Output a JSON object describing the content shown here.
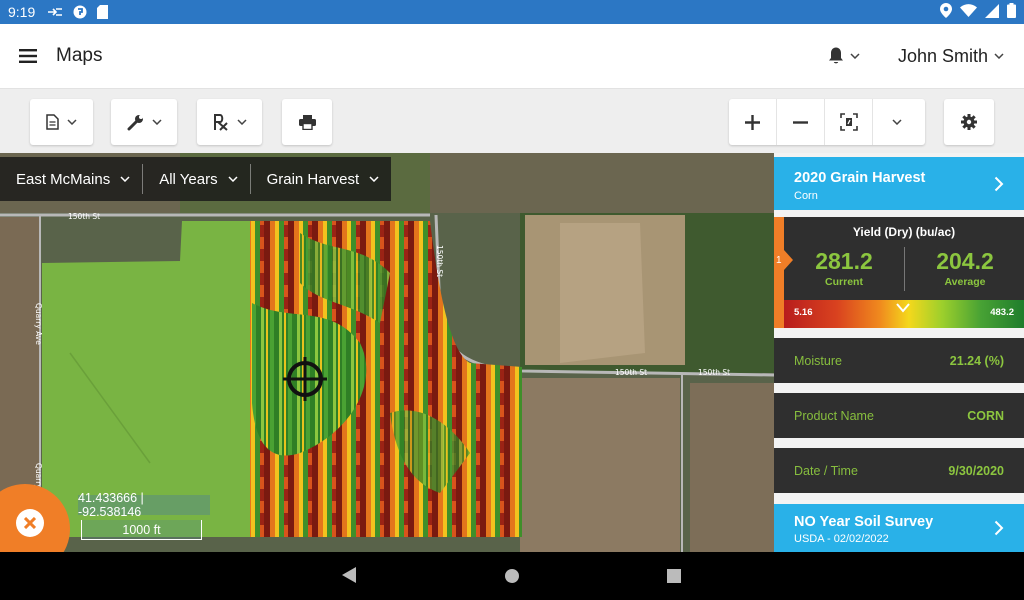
{
  "status_bar": {
    "time": "9:19"
  },
  "app_bar": {
    "title": "Maps",
    "user_name": "John Smith"
  },
  "map": {
    "filters": [
      {
        "label": "East McMains"
      },
      {
        "label": "All Years"
      },
      {
        "label": "Grain Harvest"
      }
    ],
    "road_labels": [
      "150th St",
      "150th St",
      "150th St",
      "150th St",
      "Quarry Ave",
      "Quarry Ave"
    ],
    "coordinates": "41.433666 | -92.538146",
    "scale": "1000 ft"
  },
  "panel": {
    "harvest_card": {
      "title": "2020 Grain Harvest",
      "subtitle": "Corn"
    },
    "yield": {
      "marker_number": "1",
      "title": "Yield (Dry) (bu/ac)",
      "current_value": "281.2",
      "current_label": "Current",
      "average_value": "204.2",
      "average_label": "Average",
      "scale_min": "5.16",
      "scale_max": "483.2"
    },
    "rows": [
      {
        "label": "Moisture",
        "value": "21.24 (%)"
      },
      {
        "label": "Product Name",
        "value": "CORN"
      },
      {
        "label": "Date / Time",
        "value": "9/30/2020"
      }
    ],
    "soil_card": {
      "title": "NO Year Soil Survey",
      "subtitle": "USDA - 02/02/2022"
    }
  },
  "colors": {
    "status_bar": "#2c77c4",
    "accent_blue": "#29b1e8",
    "accent_orange": "#f07e27",
    "value_green": "#8cc63f",
    "panel_dark": "#2f2f2f"
  }
}
